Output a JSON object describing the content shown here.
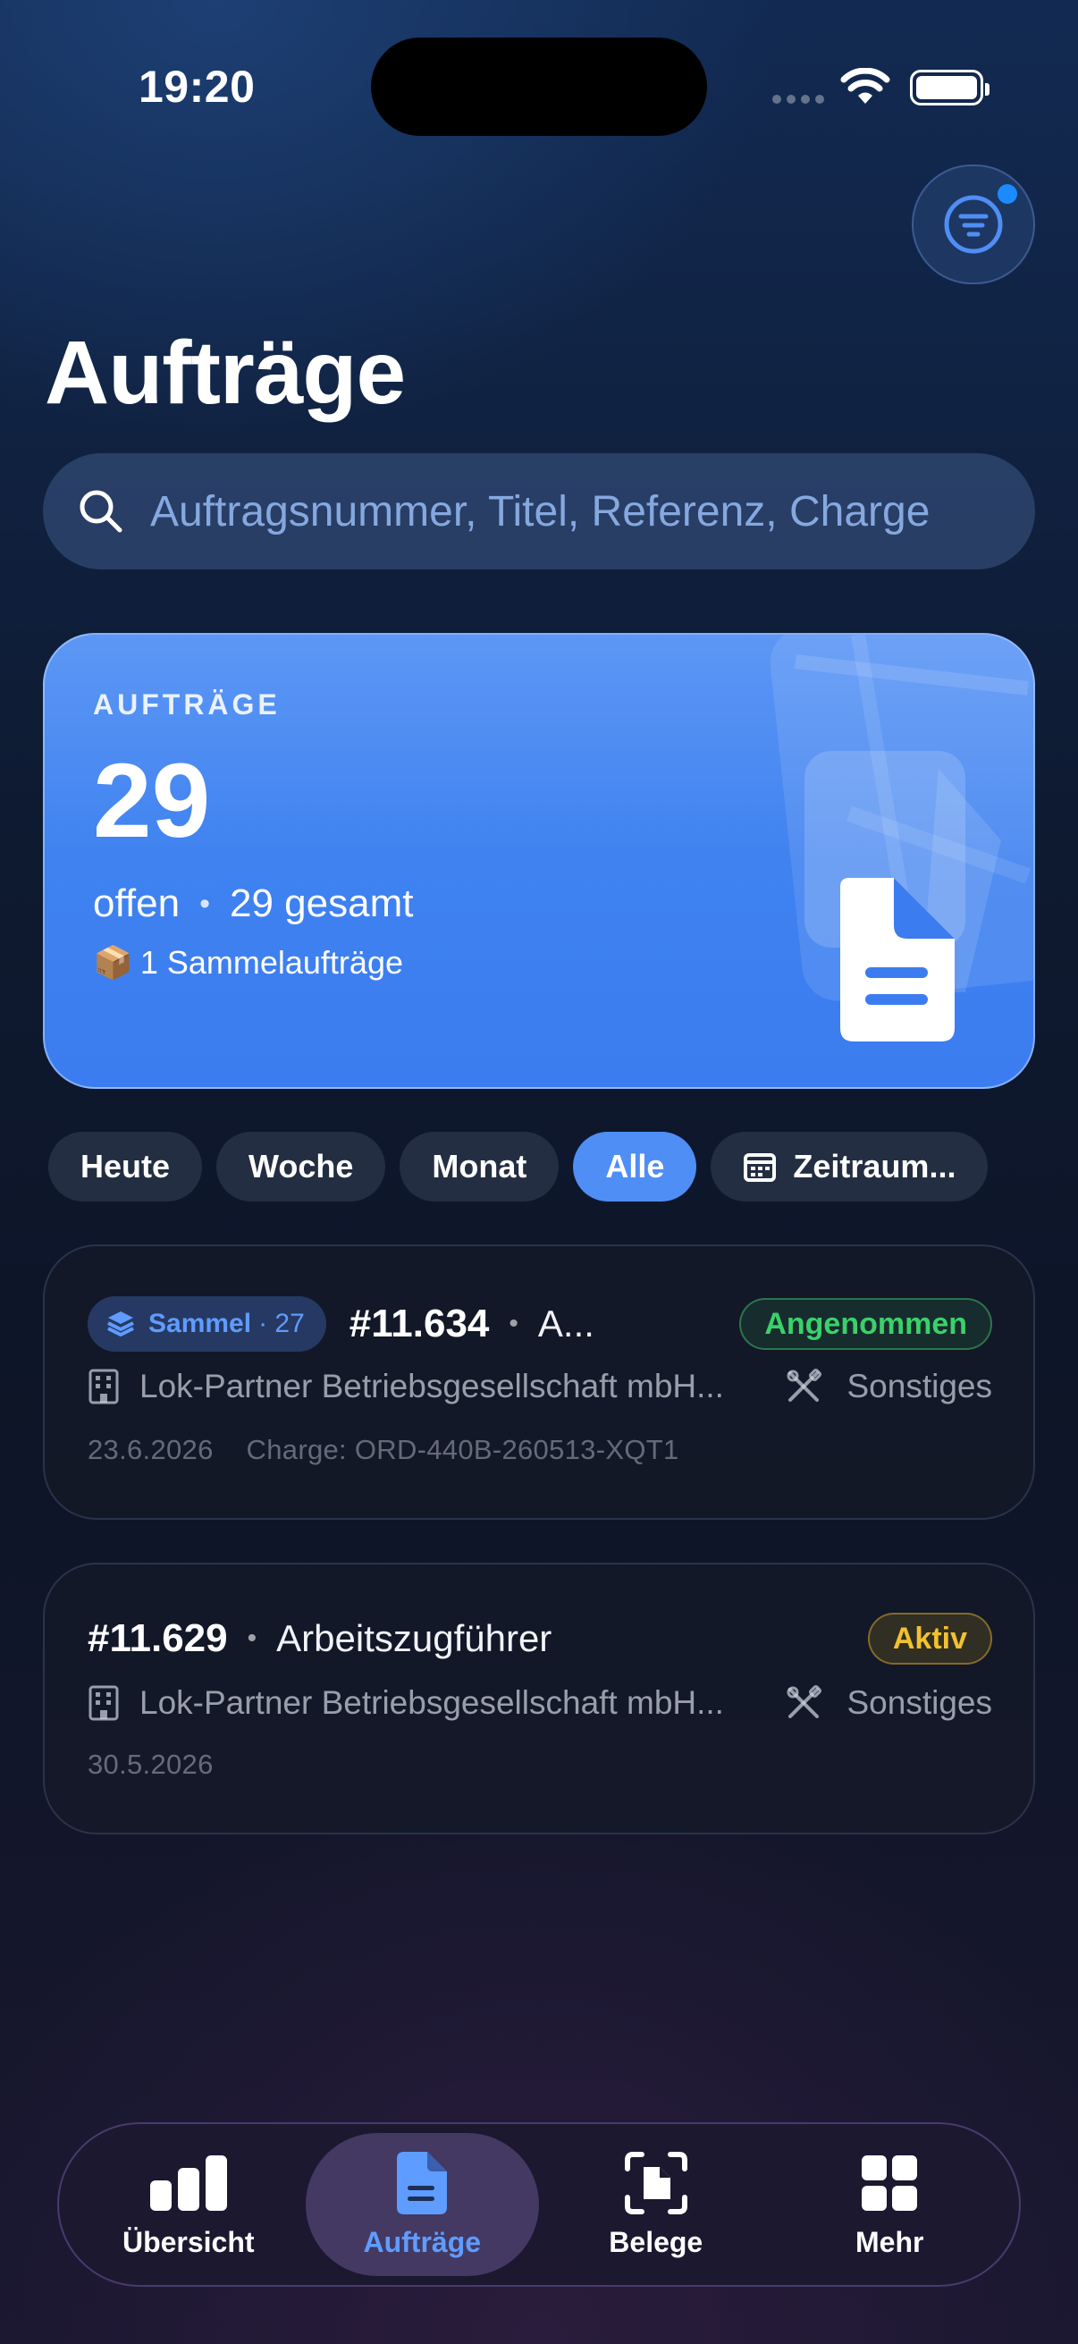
{
  "status_bar": {
    "time": "19:20"
  },
  "header": {
    "title": "Aufträge",
    "filter_icon": "filter-lines-icon"
  },
  "search": {
    "placeholder": "Auftragsnummer, Titel, Referenz, Charge"
  },
  "summary": {
    "label": "AUFTRÄGE",
    "count": "29",
    "open_text": "offen",
    "total_text": "29 gesamt",
    "batch_emoji": "📦",
    "batch_text": "1 Sammelaufträge"
  },
  "period_filters": [
    {
      "label": "Heute",
      "active": false
    },
    {
      "label": "Woche",
      "active": false
    },
    {
      "label": "Monat",
      "active": false
    },
    {
      "label": "Alle",
      "active": true
    },
    {
      "label": "Zeitraum...",
      "active": false
    }
  ],
  "orders": [
    {
      "batch_label": "Sammel",
      "batch_count": "· 27",
      "number": "#11.634",
      "title": "A...",
      "status": "Angenommen",
      "status_color": "#3ad16a",
      "company": "Lok-Partner Betriebsgesellschaft mbH...",
      "trade": "Sonstiges",
      "date": "23.6.2026",
      "charge": "Charge: ORD-440B-260513-XQT1"
    },
    {
      "number": "#11.629",
      "title": "Arbeitszugführer",
      "status": "Aktiv",
      "status_color": "#f2c12e",
      "company": "Lok-Partner Betriebsgesellschaft mbH...",
      "trade": "Sonstiges",
      "date": "30.5.2026"
    }
  ],
  "tab_bar": {
    "tabs": [
      {
        "label": "Übersicht",
        "icon": "bar-chart-icon",
        "active": false
      },
      {
        "label": "Aufträge",
        "icon": "document-icon",
        "active": true
      },
      {
        "label": "Belege",
        "icon": "scan-document-icon",
        "active": false
      },
      {
        "label": "Mehr",
        "icon": "grid-icon",
        "active": false
      }
    ]
  },
  "colors": {
    "accent": "#4f8ef5",
    "card_blue": "#3f82f0",
    "status_green": "#3ad16a",
    "status_yellow": "#f2c12e"
  }
}
